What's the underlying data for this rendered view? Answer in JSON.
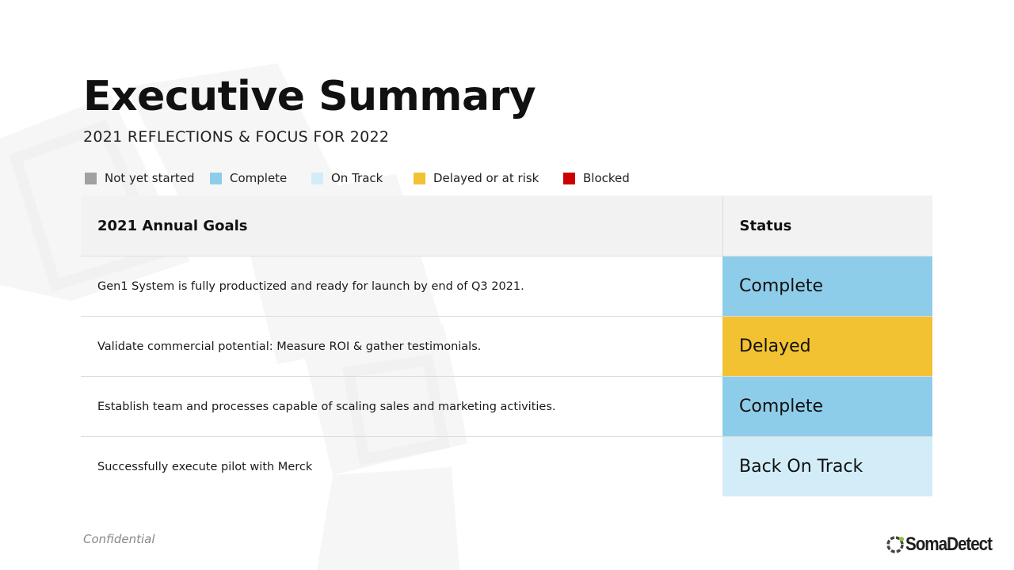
{
  "slide": {
    "title": "Executive Summary",
    "subtitle": "2021 REFLECTIONS & FOCUS FOR 2022"
  },
  "legend": [
    {
      "label": "Not yet started",
      "color": "#a0a0a0"
    },
    {
      "label": "Complete",
      "color": "#8ecde9"
    },
    {
      "label": "On Track",
      "color": "#d3edf8"
    },
    {
      "label": "Delayed or at risk",
      "color": "#f2c232"
    },
    {
      "label": "Blocked",
      "color": "#cc0000"
    }
  ],
  "table": {
    "headers": {
      "goal": "2021 Annual Goals",
      "status": "Status"
    },
    "rows": [
      {
        "goal": "Gen1 System is fully productized and ready for launch by end of Q3 2021.",
        "status": "Complete",
        "color": "#8ecde9"
      },
      {
        "goal": "Validate commercial potential: Measure ROI & gather testimonials.",
        "status": "Delayed",
        "color": "#f2c232"
      },
      {
        "goal": "Establish team and processes capable of scaling sales and marketing activities.",
        "status": "Complete",
        "color": "#8ecde9"
      },
      {
        "goal": "Successfully execute pilot with Merck",
        "status": "Back On Track",
        "color": "#d3edf8"
      }
    ]
  },
  "footer": {
    "confidential": "Confidential",
    "logo_text": "SomaDetect"
  }
}
